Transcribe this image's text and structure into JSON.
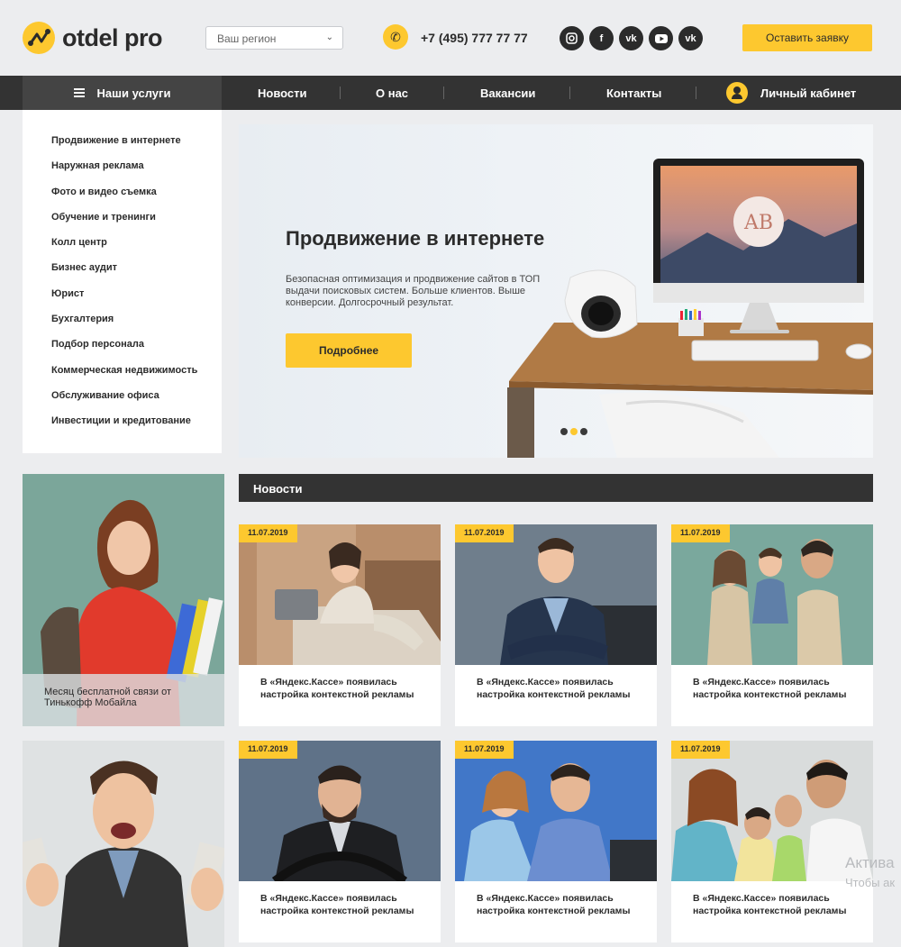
{
  "header": {
    "logo_text": "otdel pro",
    "region_placeholder": "Ваш регион",
    "phone": "+7 (495) 777 77 77",
    "social": [
      "instagram-icon",
      "facebook-icon",
      "vk-icon",
      "youtube-icon",
      "vk-icon"
    ],
    "apply_button": "Оставить заявку"
  },
  "nav": {
    "services": "Наши услуги",
    "items": [
      "Новости",
      "О нас",
      "Вакансии",
      "Контакты"
    ],
    "cabinet": "Личный кабинет"
  },
  "sidebar": {
    "items": [
      "Продвижение в интернете",
      "Наружная реклама",
      "Фото и видео съемка",
      "Обучение и тренинги",
      "Колл центр",
      "Бизнес аудит",
      "Юрист",
      "Бухгалтерия",
      "Подбор персонала",
      "Коммерческая недвижимость",
      "Обслуживание офиса",
      "Инвестиции и кредитование"
    ]
  },
  "hero": {
    "title": "Продвижение в интернете",
    "description": "Безопасная оптимизация и продвижение сайтов в ТОП выдачи поисковых систем. Больше клиентов. Выше конверсии. Долгосрочный результат.",
    "button": "Подробнее",
    "monitor_logo": "AB",
    "slides": 3,
    "active_slide": 2
  },
  "promos": [
    {
      "caption": "Месяц бесплатной связи от Тинькофф Мобайла"
    },
    {
      "caption": ""
    }
  ],
  "news": {
    "heading": "Новости",
    "cards": [
      {
        "date": "11.07.2019",
        "title": "В «Яндекс.Кассе» появилась настройка контекстной рекламы"
      },
      {
        "date": "11.07.2019",
        "title": "В «Яндекс.Кассе» появилась настройка контекстной рекламы"
      },
      {
        "date": "11.07.2019",
        "title": "В «Яндекс.Кассе» появилась настройка контекстной рекламы"
      },
      {
        "date": "11.07.2019",
        "title": "В «Яндекс.Кассе» появилась настройка контекстной рекламы"
      },
      {
        "date": "11.07.2019",
        "title": "В «Яндекс.Кассе» появилась настройка контекстной рекламы"
      },
      {
        "date": "11.07.2019",
        "title": "В «Яндекс.Кассе» появилась настройка контекстной рекламы"
      }
    ]
  },
  "watermark": {
    "line1": "Актива",
    "line2": "Чтобы ак"
  },
  "colors": {
    "accent": "#fdc82f",
    "dark": "#333333",
    "background": "#ecedef"
  }
}
